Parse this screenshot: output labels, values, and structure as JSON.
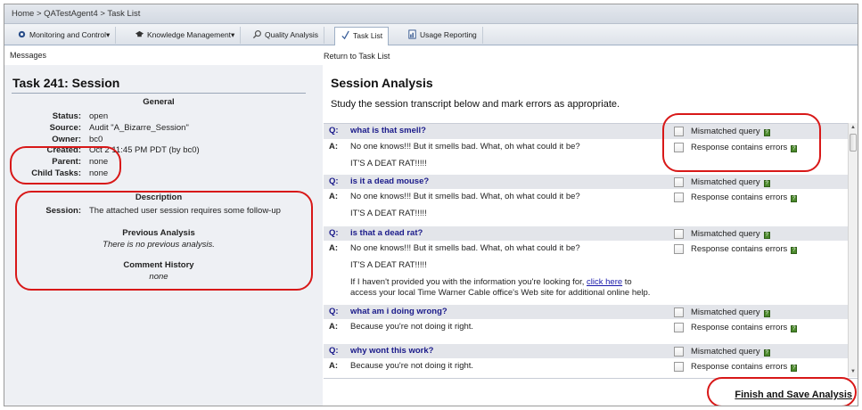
{
  "breadcrumb": "Home > QATestAgent4 > Task List",
  "tabs": [
    {
      "label": "Monitoring and Control▾",
      "icon": "gear-icon"
    },
    {
      "label": "Knowledge Management▾",
      "icon": "graduation-cap-icon"
    },
    {
      "label": "Quality Analysis",
      "icon": "magnifier-icon"
    },
    {
      "label": "Task List",
      "icon": "checkmark-icon"
    },
    {
      "label": "Usage Reporting",
      "icon": "report-icon"
    }
  ],
  "messages_label": "Messages",
  "return_link": "Return to Task List",
  "task": {
    "title": "Task 241: Session",
    "general_heading": "General",
    "fields": [
      {
        "label": "Status:",
        "value": "open"
      },
      {
        "label": "Source:",
        "value": "Audit \"A_Bizarre_Session\""
      },
      {
        "label": "Owner:",
        "value": "bc0"
      },
      {
        "label": "Created:",
        "value": "Oct 2 11:45 PM PDT (by bc0)"
      },
      {
        "label": "Parent:",
        "value": "none"
      },
      {
        "label": "Child Tasks:",
        "value": "none"
      }
    ],
    "description_heading": "Description",
    "session_label": "Session:",
    "session_value": "The attached user session requires some follow-up",
    "previous_heading": "Previous Analysis",
    "previous_value": "There is no previous analysis.",
    "comment_heading": "Comment History",
    "comment_value": "none"
  },
  "analysis": {
    "title": "Session Analysis",
    "instructions": "Study the session transcript below and mark errors as appropriate.",
    "q_prefix": "Q:",
    "a_prefix": "A:",
    "check_query": "Mismatched query",
    "check_response": "Response contains errors",
    "rat": "IT'S A DEAT RAT!!!!!",
    "items": [
      {
        "q": "what is that smell?",
        "a": "No one knows!!!  But it smells bad.  What, oh what could it be?"
      },
      {
        "q": "is it a dead mouse?",
        "a": "No one knows!!!  But it smells bad.  What, oh what could it be?"
      },
      {
        "q": "is that a dead rat?",
        "a": "No one knows!!!  But it smells bad.  What, oh what could it be?",
        "extra1": "If I haven't provided you with the information you're looking for, ",
        "link": "click here",
        "extra2": " to",
        "extra3": "access your local Time Warner Cable office's Web site for additional online help."
      },
      {
        "q": "what am i doing wrong?",
        "a": "Because you're not doing it right."
      },
      {
        "q": "why wont this work?",
        "a": "Because you're not doing it right."
      }
    ],
    "finish_label": "Finish and Save Analysis"
  },
  "colors": {
    "annotation": "#d81818",
    "question": "#1a1a8a",
    "help": "#4c8a2d"
  }
}
